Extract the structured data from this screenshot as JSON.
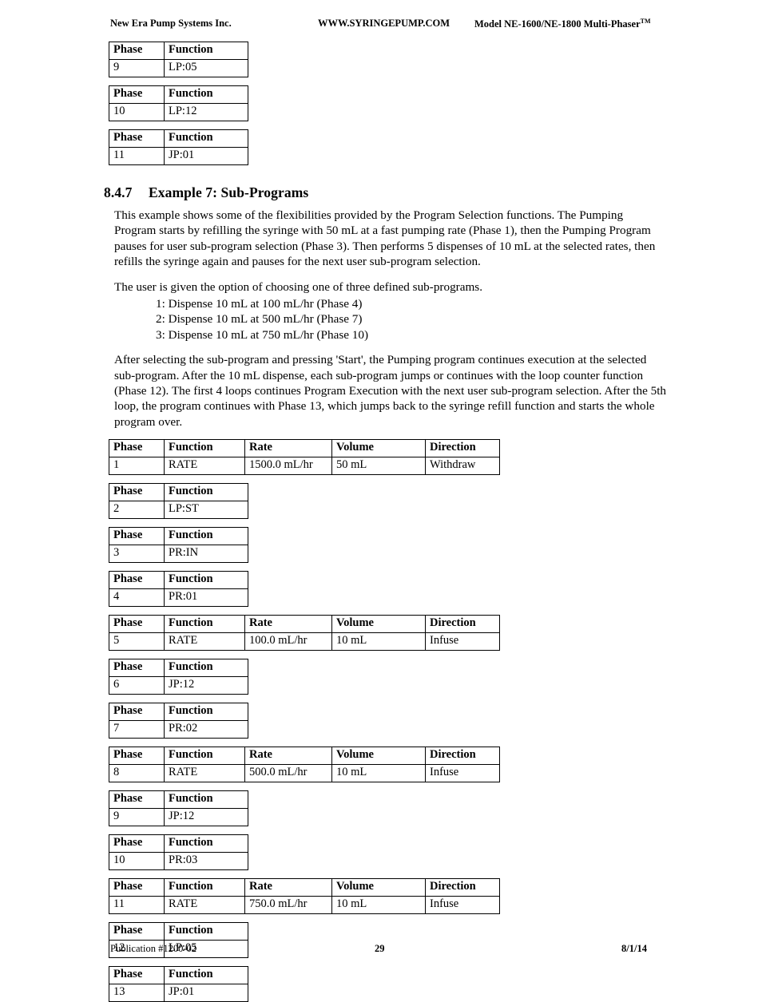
{
  "header": {
    "left": "New Era Pump Systems Inc.",
    "center": "WWW.SYRINGEPUMP.COM",
    "right": "Model NE-1600/NE-1800 Multi-Phaser",
    "right_sup": "TM"
  },
  "footer": {
    "left": "Publication  #1200-02",
    "page": "29",
    "date": "8/1/14"
  },
  "columns": {
    "phase": "Phase",
    "function": "Function",
    "rate": "Rate",
    "volume": "Volume",
    "direction": "Direction"
  },
  "top_tables": [
    {
      "phase": "9",
      "function": "LP:05"
    },
    {
      "phase": "10",
      "function": "LP:12"
    },
    {
      "phase": "11",
      "function": "JP:01"
    }
  ],
  "section": {
    "number": "8.4.7",
    "title": "Example 7:  Sub-Programs",
    "paragraphs": [
      "This example shows some of the flexibilities provided by the Program Selection functions.  The Pumping Program starts by refilling the syringe with 50 mL at a fast pumping rate (Phase 1), then the Pumping Program pauses for user sub-program selection (Phase 3).  Then performs 5 dispenses of 10 mL at the selected rates, then refills the syringe again and pauses for the next user sub-program selection.",
      "The user is given the option of choosing one of three defined sub-programs.",
      "After selecting the sub-program and pressing 'Start', the Pumping program continues execution at the selected sub-program.  After the 10 mL dispense, each sub-program jumps or continues with the loop counter function (Phase 12).  The first 4 loops continues Program Execution with the next user sub-program selection.  After the 5th loop, the program continues with Phase 13, which jumps back to the syringe refill function and starts the whole program over."
    ],
    "sub_programs": [
      "1: Dispense 10 mL at 100 mL/hr (Phase 4)",
      "2: Dispense 10 mL at 500 mL/hr (Phase 7)",
      "3: Dispense 10 mL at 750 mL/hr (Phase 10)"
    ]
  },
  "program_tables": [
    {
      "phase": "1",
      "function": "RATE",
      "rate": "1500.0 mL/hr",
      "volume": "50 mL",
      "direction": "Withdraw",
      "wide": true
    },
    {
      "phase": "2",
      "function": "LP:ST",
      "wide": false
    },
    {
      "phase": "3",
      "function": "PR:IN",
      "wide": false
    },
    {
      "phase": "4",
      "function": "PR:01",
      "wide": false
    },
    {
      "phase": "5",
      "function": "RATE",
      "rate": "100.0 mL/hr",
      "volume": "10 mL",
      "direction": "Infuse",
      "wide": true
    },
    {
      "phase": "6",
      "function": "JP:12",
      "wide": false
    },
    {
      "phase": "7",
      "function": "PR:02",
      "wide": false
    },
    {
      "phase": "8",
      "function": "RATE",
      "rate": "500.0 mL/hr",
      "volume": "10 mL",
      "direction": "Infuse",
      "wide": true
    },
    {
      "phase": "9",
      "function": "JP:12",
      "wide": false
    },
    {
      "phase": "10",
      "function": "PR:03",
      "wide": false
    },
    {
      "phase": "11",
      "function": "RATE",
      "rate": "750.0 mL/hr",
      "volume": "10 mL",
      "direction": "Infuse",
      "wide": true
    },
    {
      "phase": "12",
      "function": "LP:05",
      "wide": false
    },
    {
      "phase": "13",
      "function": "JP:01",
      "wide": false
    }
  ]
}
